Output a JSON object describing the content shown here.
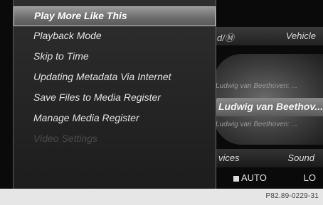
{
  "menu": {
    "items": [
      {
        "label": "Play More Like This",
        "state": "selected"
      },
      {
        "label": "Playback Mode",
        "state": "normal"
      },
      {
        "label": "Skip to Time",
        "state": "normal"
      },
      {
        "label": "Updating Metadata Via Internet",
        "state": "normal"
      },
      {
        "label": "Save Files to Media Register",
        "state": "normal"
      },
      {
        "label": "Manage Media Register",
        "state": "normal"
      },
      {
        "label": "Video Settings",
        "state": "disabled"
      }
    ]
  },
  "background_screen": {
    "tab_left": "d/Ⓜ",
    "tab_right": "Vehicle",
    "list": {
      "row1": "Ludwig van Beethoven: ...",
      "row2": "Ludwig van Beethov...",
      "row3": "Ludwig van Beethoven: ..."
    },
    "bottom_bar": {
      "services": "vices",
      "sound": "Sound"
    },
    "status": {
      "climate_mode": "AUTO",
      "climate_level": "LO"
    }
  },
  "footer": {
    "figure_code": "P82.89-0229-31"
  }
}
